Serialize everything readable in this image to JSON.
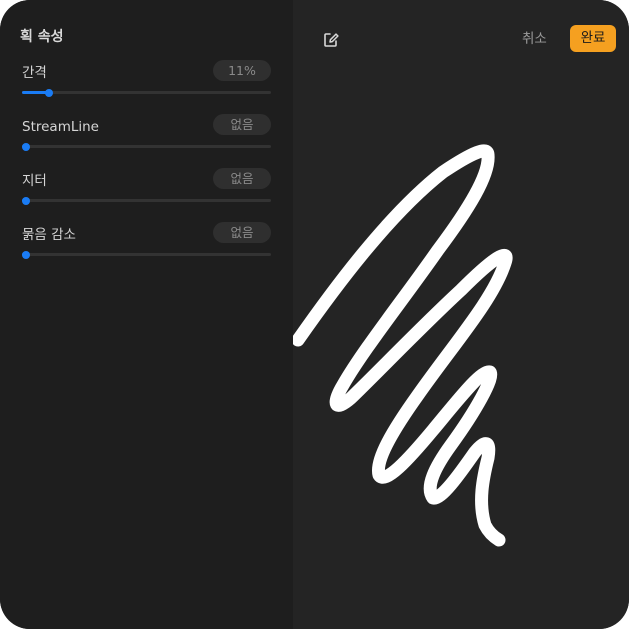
{
  "panel": {
    "title": "획 속성",
    "properties": [
      {
        "label": "간격",
        "value": "11%",
        "level": 0.11
      },
      {
        "label": "StreamLine",
        "value": "없음",
        "level": 0
      },
      {
        "label": "지터",
        "value": "없음",
        "level": 0
      },
      {
        "label": "묽음 감소",
        "value": "없음",
        "level": 0
      }
    ]
  },
  "toolbar": {
    "edit_icon": "edit-icon",
    "cancel_label": "취소",
    "done_label": "완료"
  },
  "colors": {
    "accent": "#1a7cf5",
    "done_button": "#f5a020",
    "panel_background": "#1e1e1e",
    "canvas_background": "#242424",
    "stroke": "#ffffff"
  }
}
